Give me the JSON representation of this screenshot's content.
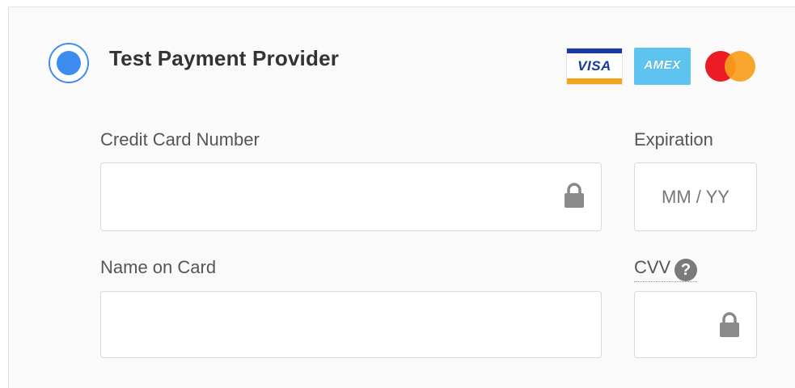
{
  "provider": {
    "title": "Test Payment Provider",
    "selected": true,
    "card_logos": [
      "VISA",
      "AMEX",
      "mastercard"
    ]
  },
  "fields": {
    "card_number": {
      "label": "Credit Card Number",
      "value": "",
      "placeholder": ""
    },
    "expiration": {
      "label": "Expiration",
      "value": "",
      "placeholder": "MM / YY"
    },
    "name_on_card": {
      "label": "Name on Card",
      "value": "",
      "placeholder": ""
    },
    "cvv": {
      "label": "CVV",
      "value": "",
      "placeholder": ""
    }
  },
  "icons": {
    "lock": "lock-icon",
    "help": "question-circle-icon"
  },
  "colors": {
    "accent": "#3f8cf0",
    "visa_blue": "#1a3aa0",
    "visa_gold": "#f2a51a",
    "amex_blue": "#5ec3ee",
    "mc_red": "#eb1c26",
    "mc_orange": "#f79e1b"
  }
}
